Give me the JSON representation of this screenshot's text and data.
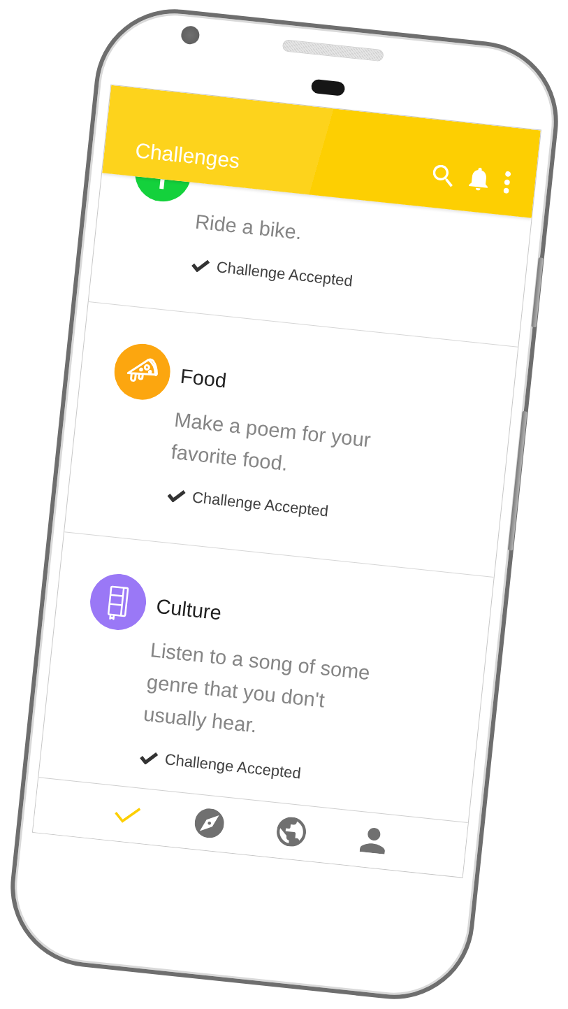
{
  "app_bar": {
    "title": "Challenges"
  },
  "cards": [
    {
      "color": "#14d13c",
      "description": "Ride a bike.",
      "status": "Challenge Accepted"
    },
    {
      "title": "Food",
      "color": "#fca60f",
      "description": "Make a poem for your favorite food.",
      "status": "Challenge Accepted"
    },
    {
      "title": "Culture",
      "color": "#9a78f6",
      "description": "Listen to a song of some genre that you don't usually hear.",
      "status": "Challenge Accepted"
    }
  ],
  "bottom_nav": [
    {
      "selected": true
    },
    {
      "selected": false
    },
    {
      "selected": false
    },
    {
      "selected": false
    }
  ]
}
